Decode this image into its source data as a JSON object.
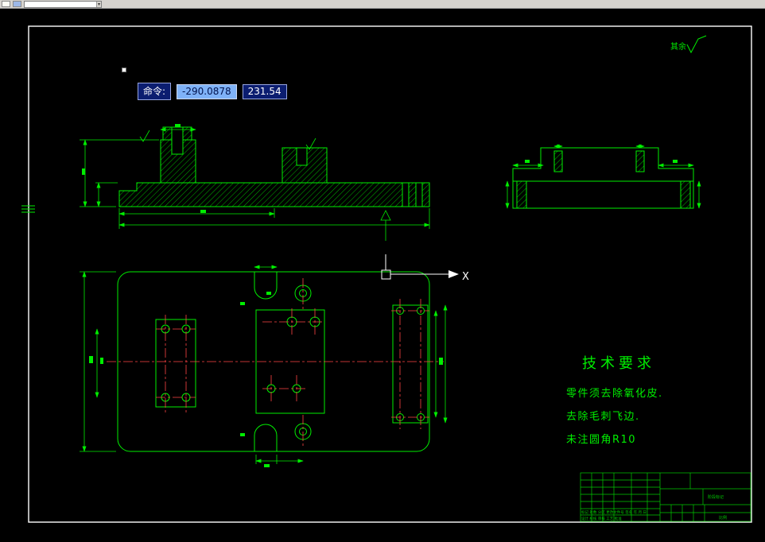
{
  "colors": {
    "drawing_green": "#00ee00",
    "centerline_red": "#ff4444",
    "frame_white": "#ffffff",
    "tooltip_navy": "#0b1d70",
    "tooltip_selection_blue": "#7fb2f7",
    "canvas_black": "#000000",
    "toolbar_gray": "#d6d3ce"
  },
  "toolbar": {
    "combo_value": "",
    "dropdown_icon": "▾"
  },
  "command_tooltip": {
    "label": "命令:",
    "x_value": "-290.0878",
    "y_value": "231.54"
  },
  "ucs": {
    "x_axis_label": "X"
  },
  "surface_note": {
    "text": "其余"
  },
  "tech_requirements": {
    "title": "技术要求",
    "lines": [
      "零件须去除氧化皮.",
      "去除毛刺飞边.",
      "未注圆角R10"
    ]
  },
  "title_block": {
    "revision_row": "标记 处数 分区 更改文件号 签名 年.月.日",
    "roles_row": "设计  校核  审核  工艺  批准",
    "stage_label": "阶段标记",
    "scale_label": "比例"
  }
}
